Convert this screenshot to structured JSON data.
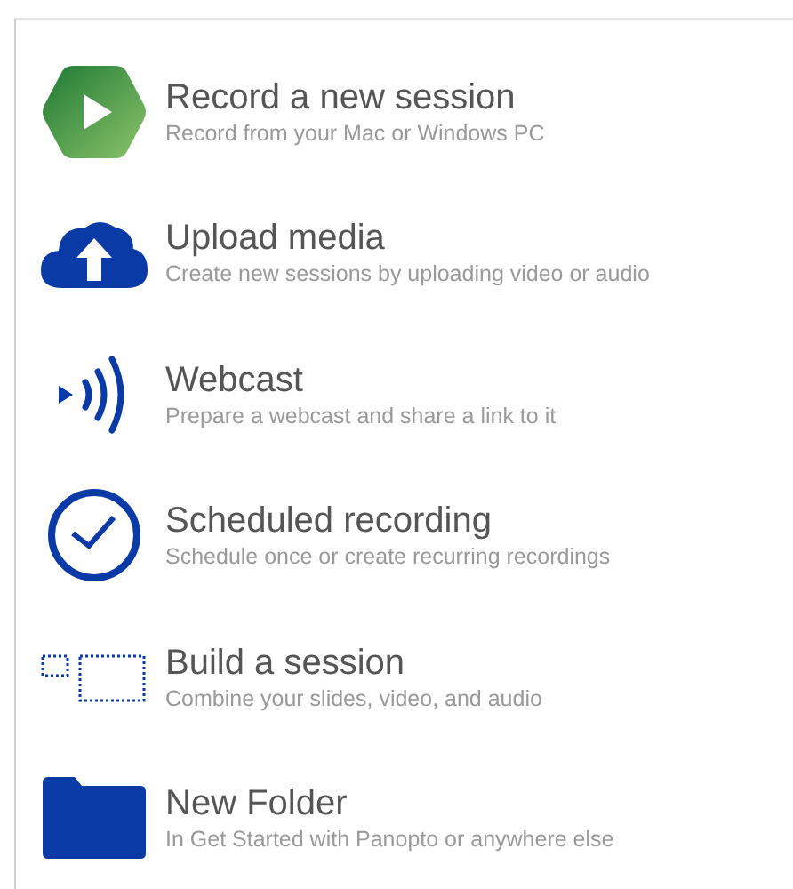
{
  "menu": {
    "items": [
      {
        "kind": "record",
        "title": "Record a new session",
        "subtitle": "Record from your Mac or Windows PC"
      },
      {
        "kind": "upload",
        "title": "Upload media",
        "subtitle": "Create new sessions by uploading video or audio"
      },
      {
        "kind": "webcast",
        "title": "Webcast",
        "subtitle": "Prepare a webcast and share a link to it"
      },
      {
        "kind": "schedule",
        "title": "Scheduled recording",
        "subtitle": "Schedule once or create recurring recordings"
      },
      {
        "kind": "build",
        "title": "Build a session",
        "subtitle": "Combine your slides, video, and audio"
      },
      {
        "kind": "folder",
        "title": "New Folder",
        "subtitle": "In Get Started with Panopto or anywhere else"
      }
    ]
  }
}
